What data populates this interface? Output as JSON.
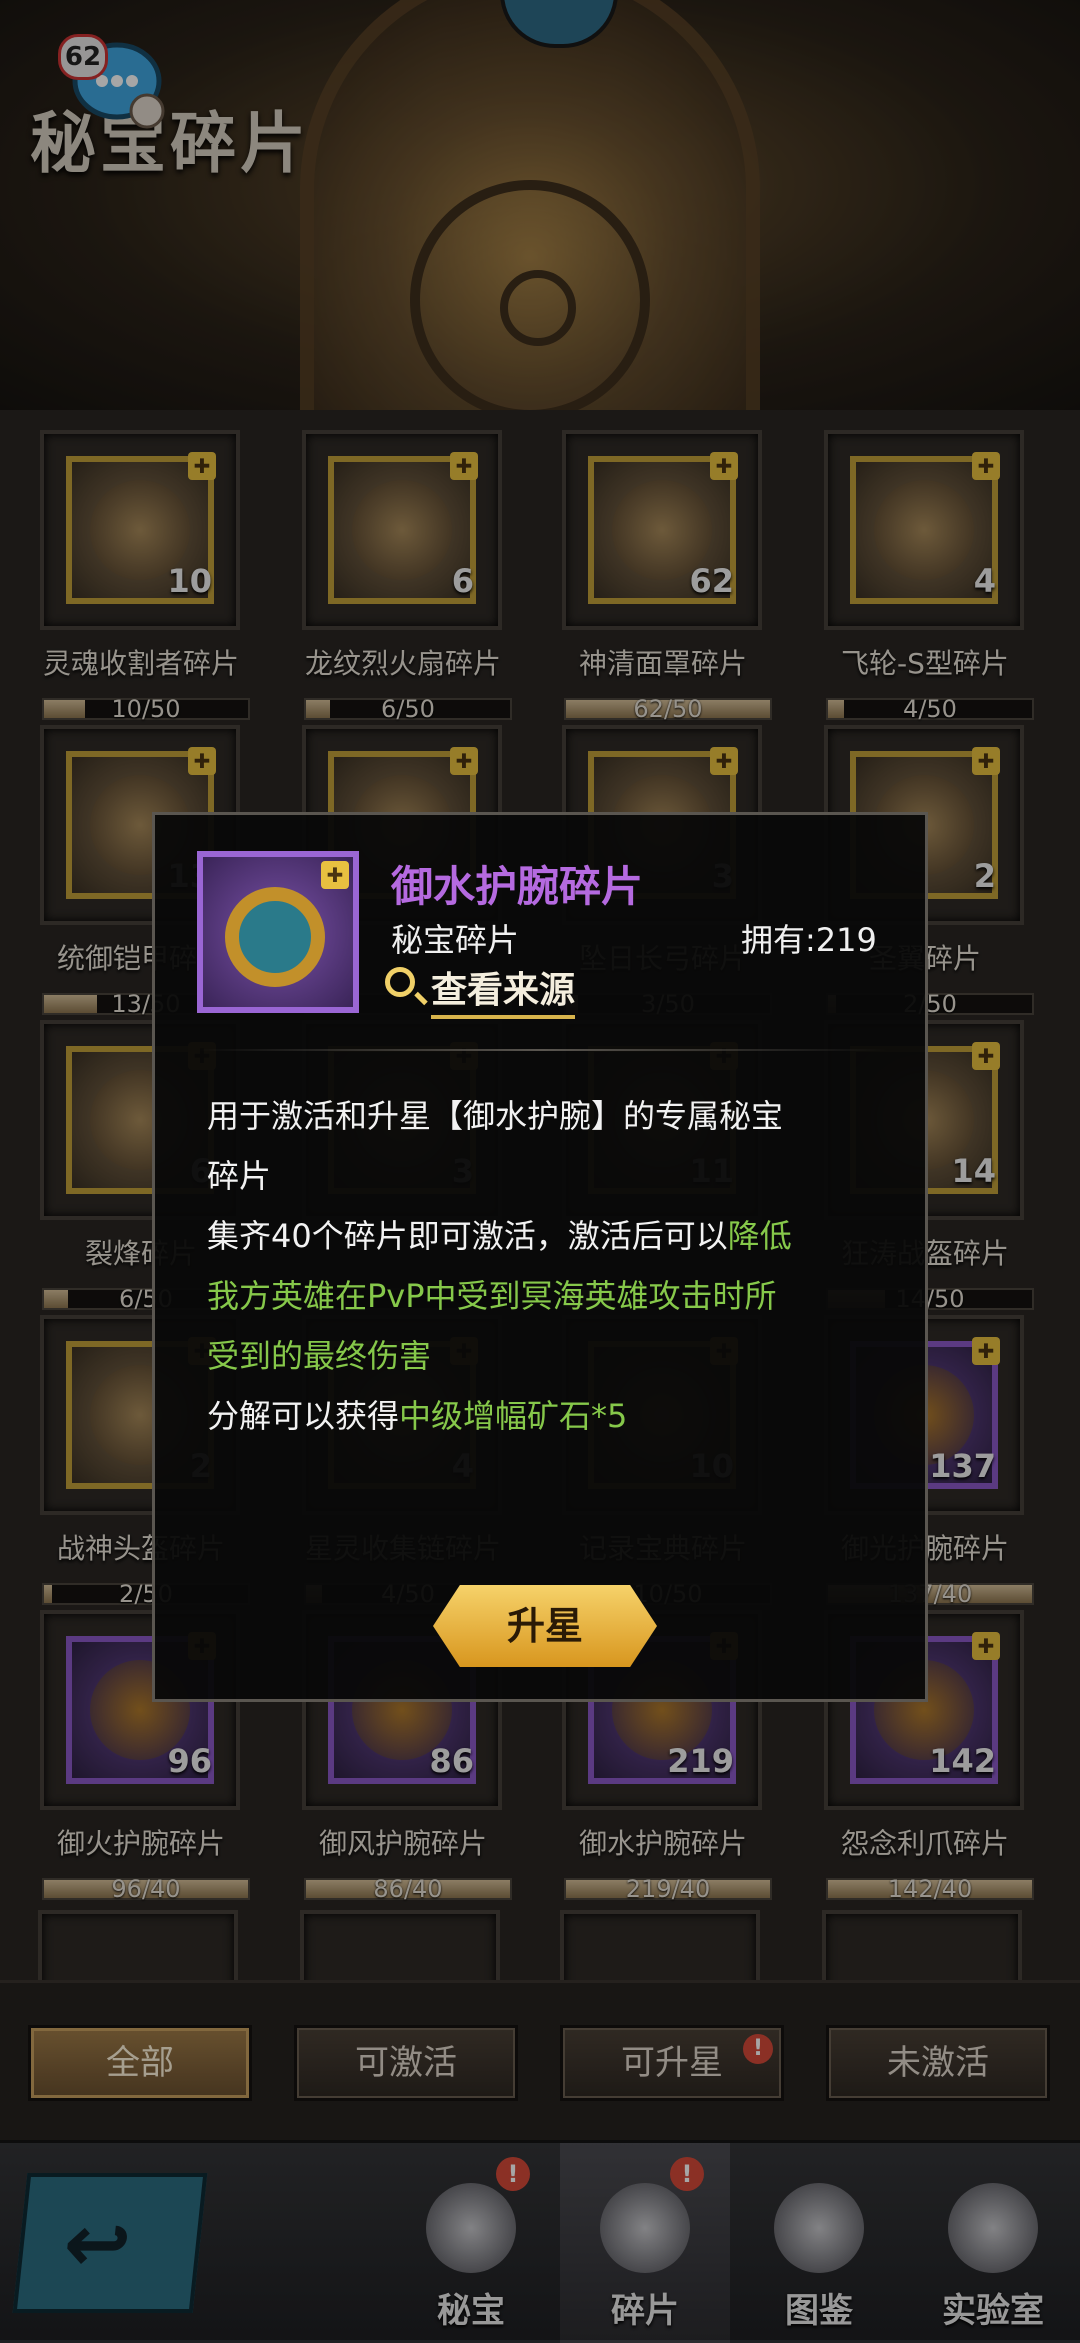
{
  "header": {
    "title": "秘宝碎片",
    "chat_count": "62"
  },
  "cards": [
    {
      "name": "灵魂收割者碎片",
      "count": "10",
      "progress": "10/50",
      "fraction": 0.2,
      "rarity": "gold"
    },
    {
      "name": "龙纹烈火扇碎片",
      "count": "6",
      "progress": "6/50",
      "fraction": 0.12,
      "rarity": "gold"
    },
    {
      "name": "神清面罩碎片",
      "count": "62",
      "progress": "62/50",
      "fraction": 1.0,
      "rarity": "gold"
    },
    {
      "name": "飞轮-S型碎片",
      "count": "4",
      "progress": "4/50",
      "fraction": 0.08,
      "rarity": "gold"
    },
    {
      "name": "统御铠甲碎片",
      "count": "13",
      "progress": "13/50",
      "fraction": 0.26,
      "rarity": "gold"
    },
    {
      "name": "",
      "count": "",
      "progress": "",
      "fraction": 0.0,
      "rarity": "gold"
    },
    {
      "name": "坠日长弓碎片",
      "count": "3",
      "progress": "3/50",
      "fraction": 0.06,
      "rarity": "gold"
    },
    {
      "name": "圣翼碎片",
      "count": "2",
      "progress": "2/50",
      "fraction": 0.04,
      "rarity": "gold"
    },
    {
      "name": "裂烽碎片",
      "count": "6",
      "progress": "6/50",
      "fraction": 0.12,
      "rarity": "gold"
    },
    {
      "name": "",
      "count": "3",
      "progress": "",
      "fraction": 0.06,
      "rarity": "gold"
    },
    {
      "name": "",
      "count": "11",
      "progress": "",
      "fraction": 0.22,
      "rarity": "gold"
    },
    {
      "name": "狂涛战盔碎片",
      "count": "14",
      "progress": "14/50",
      "fraction": 0.28,
      "rarity": "gold"
    },
    {
      "name": "战神头盔碎片",
      "count": "2",
      "progress": "2/50",
      "fraction": 0.04,
      "rarity": "gold"
    },
    {
      "name": "星灵收集链碎片",
      "count": "4",
      "progress": "4/50",
      "fraction": 0.08,
      "rarity": "gold"
    },
    {
      "name": "记录宝典碎片",
      "count": "10",
      "progress": "10/50",
      "fraction": 0.2,
      "rarity": "gold"
    },
    {
      "name": "御光护腕碎片",
      "count": "137",
      "progress": "137/40",
      "fraction": 1.0,
      "rarity": "purple"
    },
    {
      "name": "御火护腕碎片",
      "count": "96",
      "progress": "96/40",
      "fraction": 1.0,
      "rarity": "purple"
    },
    {
      "name": "御风护腕碎片",
      "count": "86",
      "progress": "86/40",
      "fraction": 1.0,
      "rarity": "purple"
    },
    {
      "name": "御水护腕碎片",
      "count": "219",
      "progress": "219/40",
      "fraction": 1.0,
      "rarity": "purple"
    },
    {
      "name": "怨念利爪碎片",
      "count": "142",
      "progress": "142/40",
      "fraction": 1.0,
      "rarity": "purple"
    }
  ],
  "filters": [
    {
      "label": "全部",
      "active": true,
      "badge": ""
    },
    {
      "label": "可激活",
      "active": false,
      "badge": ""
    },
    {
      "label": "可升星",
      "active": false,
      "badge": "!"
    },
    {
      "label": "未激活",
      "active": false,
      "badge": ""
    }
  ],
  "nav": [
    {
      "label": "秘宝",
      "badge": "!",
      "active": false,
      "icon": "sword-shield-icon"
    },
    {
      "label": "碎片",
      "badge": "!",
      "active": true,
      "icon": "fragment-orb-icon"
    },
    {
      "label": "图鉴",
      "badge": "",
      "active": false,
      "icon": "codex-icon"
    },
    {
      "label": "实验室",
      "badge": "",
      "active": false,
      "icon": "lab-robot-icon"
    }
  ],
  "dialog": {
    "item_name": "御水护腕碎片",
    "item_type": "秘宝碎片",
    "owned": "拥有:219",
    "view_source": "查看来源",
    "desc_line1": "用于激活和升星【御水护腕】的专属秘宝",
    "desc_line2": "碎片",
    "desc_line3_a": "集齐40个碎片即可激活，激活后可以",
    "desc_line3_b": "降低",
    "desc_line4": "我方英雄在PvP中受到冥海英雄攻击时所",
    "desc_line5": "受到的最终伤害",
    "desc_line6_a": "分解可以获得",
    "desc_line6_b": "中级增幅矿石*5",
    "upgrade_label": "升星"
  },
  "colors": {
    "rare_purple": "#b56ae0",
    "highlight_green": "#86c84a",
    "gold_button": "#e8b444"
  }
}
